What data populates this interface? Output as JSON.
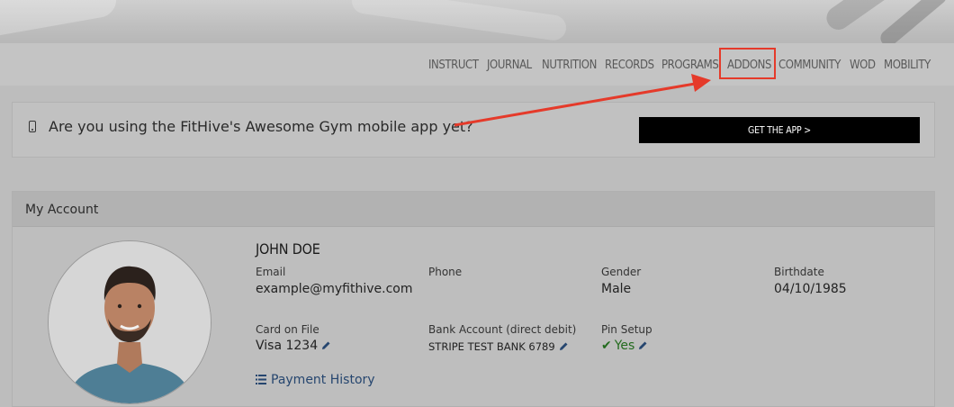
{
  "nav": {
    "items": [
      "INSTRUCT",
      "JOURNAL",
      "NUTRITION",
      "RECORDS",
      "PROGRAMS",
      "ADDONS",
      "COMMUNITY",
      "WOD",
      "MOBILITY"
    ]
  },
  "banner": {
    "message": "Are you using the FitHive's Awesome Gym mobile app yet?",
    "button_label": "GET THE APP >"
  },
  "account": {
    "header": "My Account",
    "name": "JOHN DOE",
    "email_label": "Email",
    "email": "example@myfithive.com",
    "phone_label": "Phone",
    "phone": "",
    "gender_label": "Gender",
    "gender": "Male",
    "birthdate_label": "Birthdate",
    "birthdate": "04/10/1985",
    "card_label": "Card on File",
    "card": "Visa 1234",
    "bank_label": "Bank Account (direct debit)",
    "bank": "STRIPE TEST BANK 6789",
    "pin_label": "Pin Setup",
    "pin": "Yes",
    "payment_history": "Payment History"
  },
  "colors": {
    "highlight": "#e53a2a",
    "link": "#26466f",
    "success": "#236b1e",
    "button_bg": "#000000"
  },
  "icons": {
    "banner": "mobile-phone-icon",
    "edit": "pencil-icon",
    "pin": "checkmark-icon",
    "history": "list-icon"
  }
}
